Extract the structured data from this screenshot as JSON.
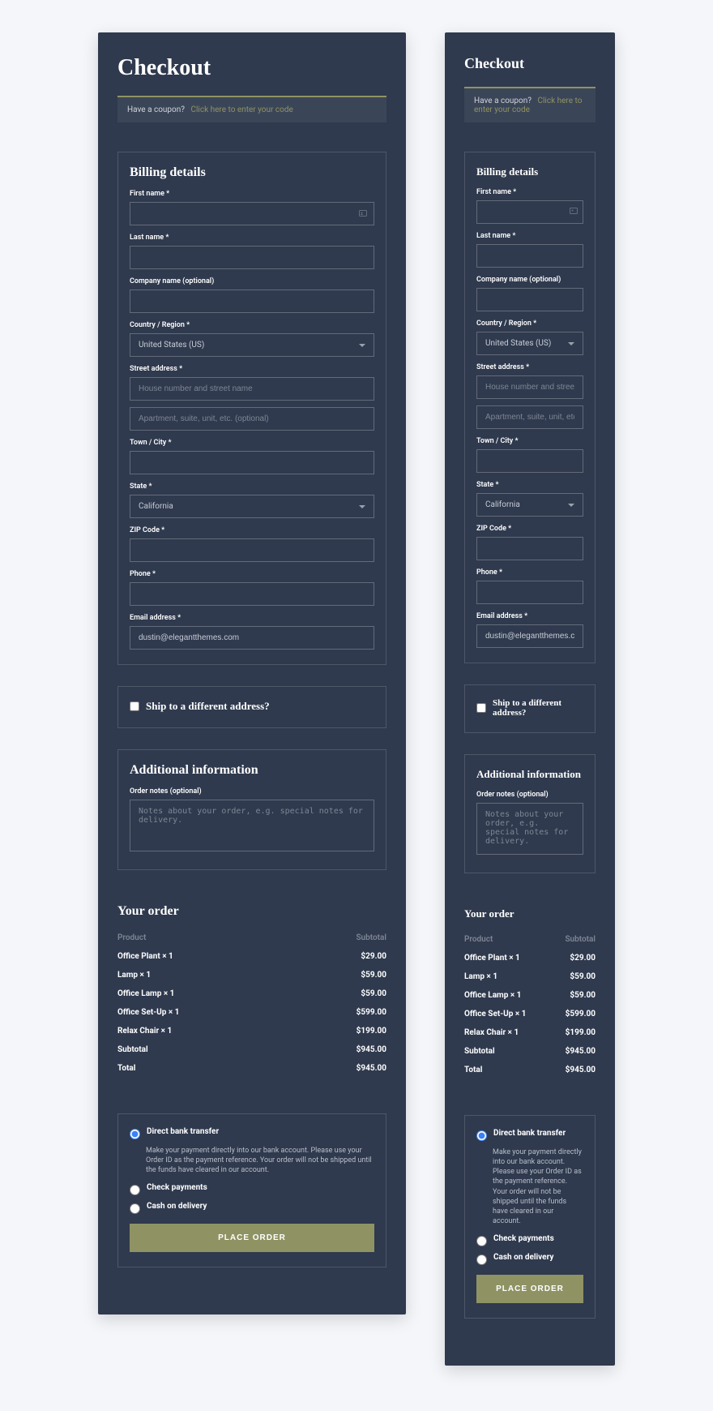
{
  "page": {
    "title": "Checkout"
  },
  "coupon": {
    "prompt": "Have a coupon?",
    "link": "Click here to enter your code"
  },
  "billing": {
    "heading": "Billing details",
    "labels": {
      "first_name": "First name *",
      "last_name": "Last name *",
      "company": "Company name (optional)",
      "country": "Country / Region *",
      "street": "Street address *",
      "city": "Town / City *",
      "state": "State *",
      "zip": "ZIP Code *",
      "phone": "Phone *",
      "email": "Email address *"
    },
    "placeholders": {
      "street1": "House number and street name",
      "street2": "Apartment, suite, unit, etc. (optional)"
    },
    "values": {
      "country": "United States (US)",
      "state": "California",
      "email": "dustin@elegantthemes.com"
    }
  },
  "shipping": {
    "label": "Ship to a different address?"
  },
  "additional": {
    "heading": "Additional information",
    "notes_label": "Order notes (optional)",
    "notes_placeholder": "Notes about your order, e.g. special notes for delivery."
  },
  "order": {
    "heading": "Your order",
    "columns": {
      "product": "Product",
      "subtotal": "Subtotal"
    },
    "items": [
      {
        "name": "Office Plant  × 1",
        "price": "$29.00"
      },
      {
        "name": "Lamp  × 1",
        "price": "$59.00"
      },
      {
        "name": "Office Lamp  × 1",
        "price": "$59.00"
      },
      {
        "name": "Office Set-Up  × 1",
        "price": "$599.00"
      },
      {
        "name": "Relax Chair  × 1",
        "price": "$199.00"
      }
    ],
    "subtotal_label": "Subtotal",
    "subtotal_value": "$945.00",
    "total_label": "Total",
    "total_value": "$945.00"
  },
  "payment": {
    "options": [
      {
        "label": "Direct bank transfer",
        "selected": true,
        "desc": "Make your payment directly into our bank account. Please use your Order ID as the payment reference. Your order will not be shipped until the funds have cleared in our account."
      },
      {
        "label": "Check payments",
        "selected": false
      },
      {
        "label": "Cash on delivery",
        "selected": false
      }
    ],
    "button": "PLACE ORDER"
  }
}
